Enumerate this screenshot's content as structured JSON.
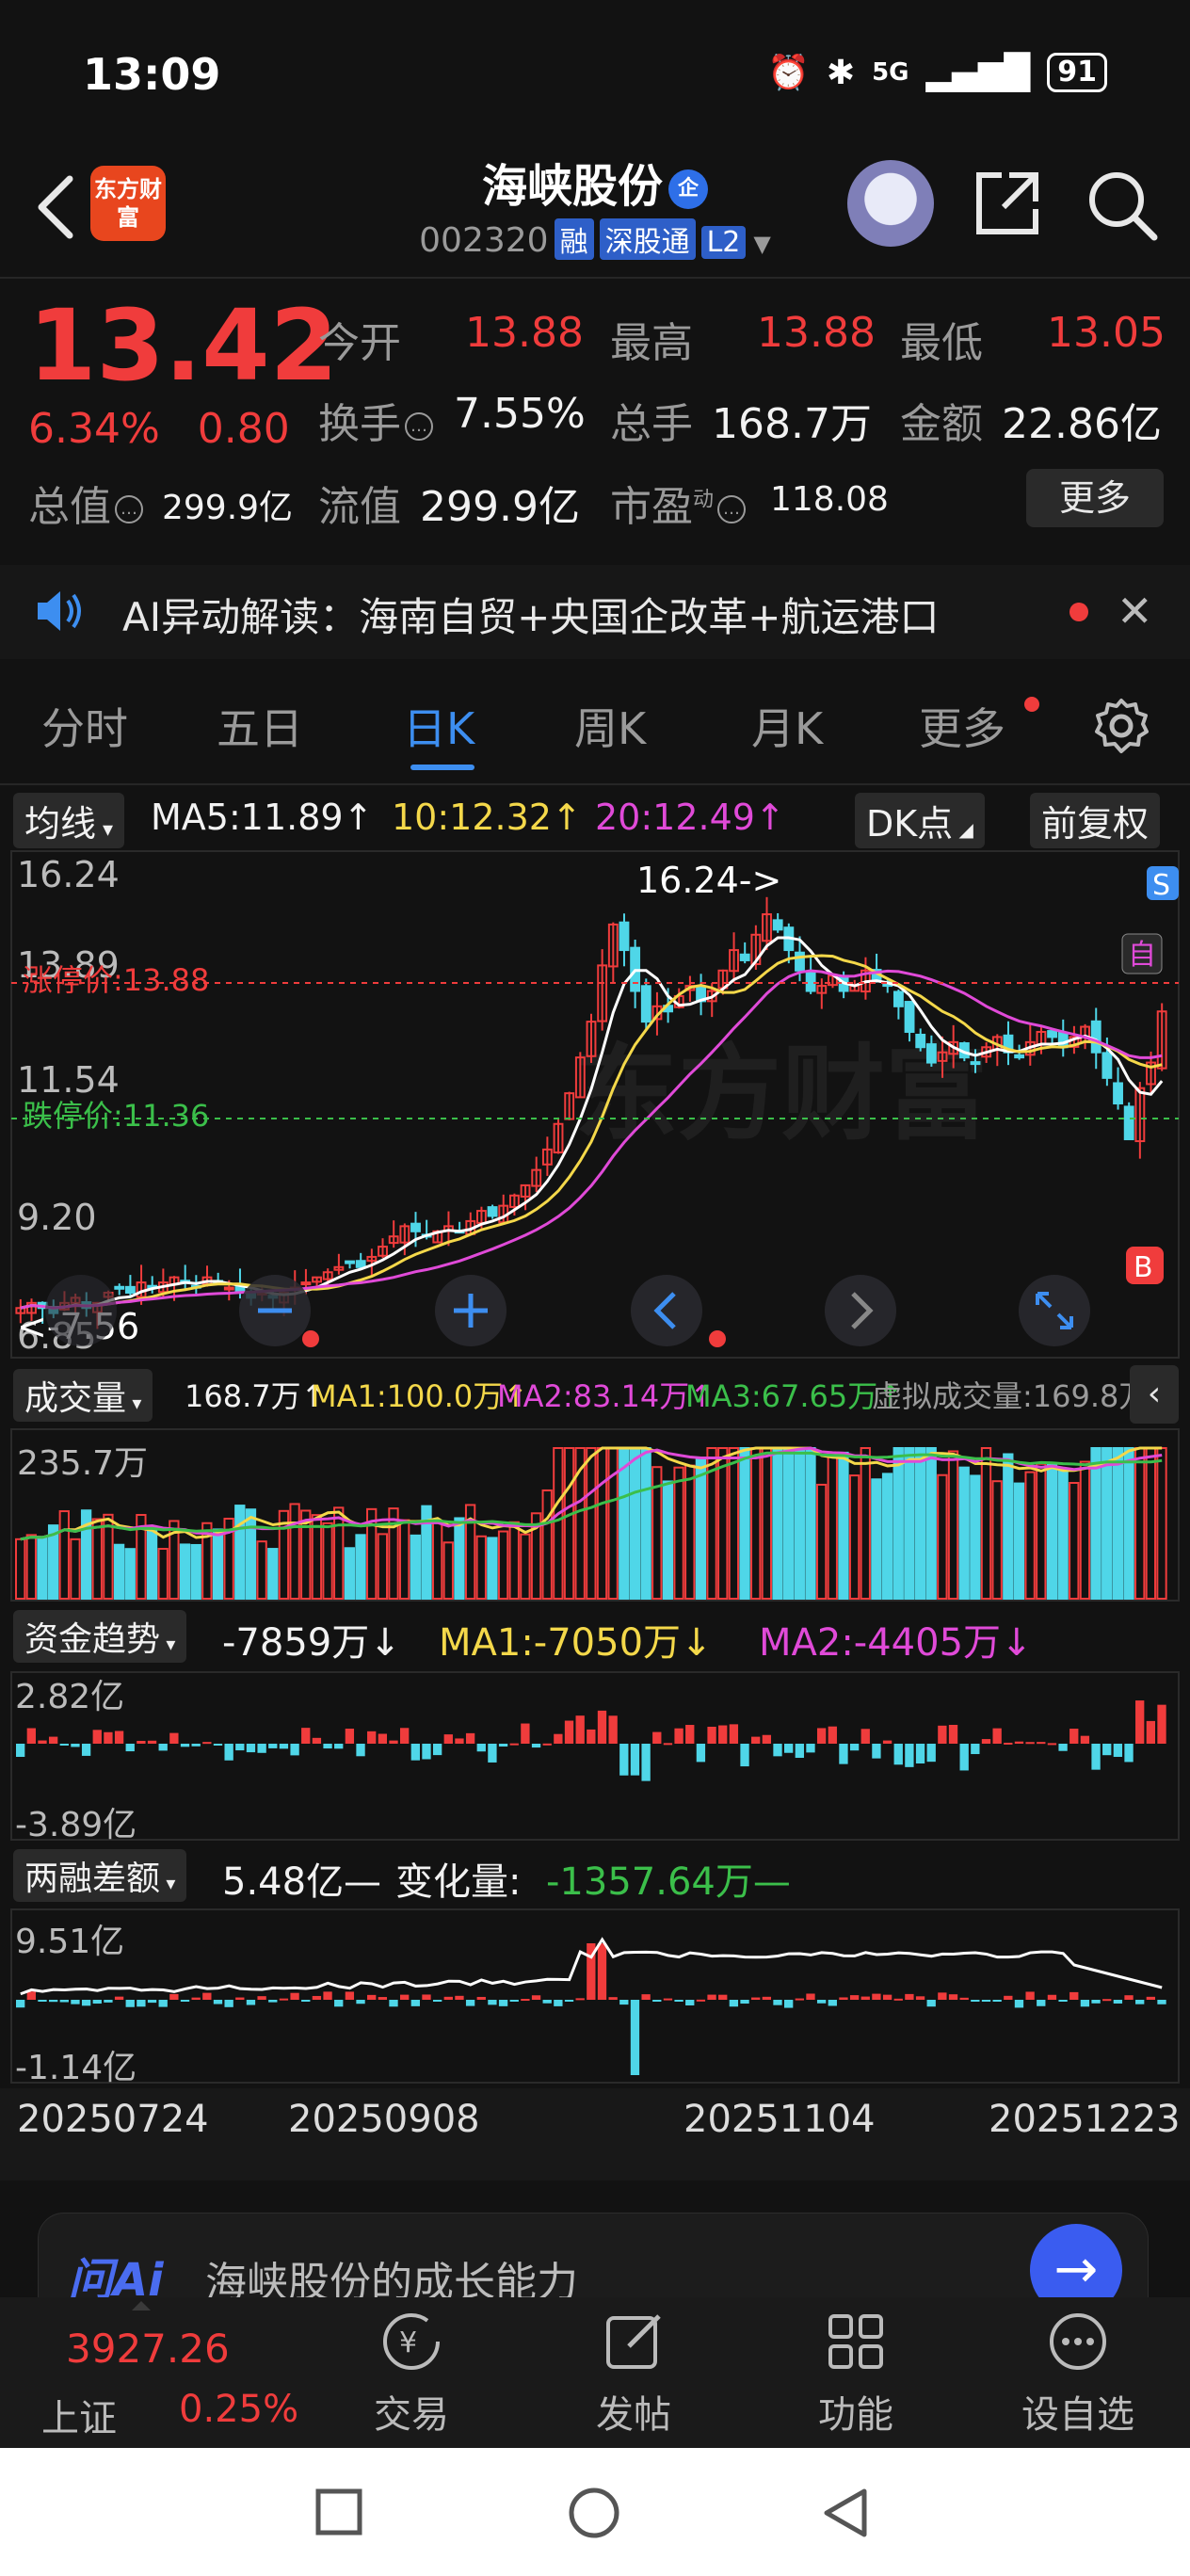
{
  "status": {
    "time": "13:09",
    "network": "5G",
    "battery": "91"
  },
  "header": {
    "logo_text": "东方财富",
    "name": "海峡股份",
    "name_badge": "企",
    "code": "002320",
    "tags": [
      "融",
      "深股通",
      "L2"
    ]
  },
  "quote": {
    "price": "13.42",
    "change_pct": "6.34%",
    "change_amt": "0.80",
    "open_label": "今开",
    "open": "13.88",
    "high_label": "最高",
    "high": "13.88",
    "low_label": "最低",
    "low": "13.05",
    "turnover_label": "换手",
    "turnover": "7.55%",
    "volume_label": "总手",
    "volume": "168.7万",
    "amount_label": "金额",
    "amount": "22.86亿",
    "mktcap_label": "总值",
    "mktcap": "299.9亿",
    "float_label": "流值",
    "float": "299.9亿",
    "pe_label": "市盈",
    "pe_sup": "动",
    "pe": "118.08",
    "more_label": "更多"
  },
  "ai_bar": {
    "text": "AI异动解读：海南自贸+央国企改革+航运港口"
  },
  "tabs": [
    "分时",
    "五日",
    "日K",
    "周K",
    "月K",
    "更多"
  ],
  "active_tab": "日K",
  "kline": {
    "ma_chip": "均线",
    "ma5": "MA5:11.89↑",
    "ma10": "10:12.32↑",
    "ma20": "20:12.49↑",
    "dk_chip": "DK点",
    "adj_chip": "前复权",
    "y_labels": [
      "16.24",
      "13.89",
      "11.54",
      "9.20",
      "6.85"
    ],
    "limit_up": "涨停价:13.88",
    "limit_down": "跌停价:11.36",
    "high_marker": "16.24->",
    "low_marker": "<-7.56",
    "badge_s": "S",
    "badge_zi": "自",
    "badge_b": "B",
    "watermark": "东方财富"
  },
  "volume_panel": {
    "chip": "成交量",
    "vol": "168.7万↑",
    "ma1": "MA1:100.0万↑",
    "ma2": "MA2:83.14万↑",
    "ma3": "MA3:67.65万↑",
    "virtual": "虚拟成交量:169.8万",
    "y_top": "235.7万"
  },
  "fund_panel": {
    "chip": "资金趋势",
    "val": "-7859万↓",
    "ma1": "MA1:-7050万↓",
    "ma2": "MA2:-4405万↓",
    "y_top": "2.82亿",
    "y_bottom": "-3.89亿"
  },
  "margin_panel": {
    "chip": "两融差额",
    "val": "5.48亿—",
    "change_label": "变化量:",
    "change": "-1357.64万—",
    "y_top": "9.51亿",
    "y_bottom": "-1.14亿"
  },
  "dates": [
    "20250724",
    "20250908",
    "20251104",
    "20251223"
  ],
  "ask_ai": {
    "logo": "问Ai",
    "text": "海峡股份的成长能力"
  },
  "index": {
    "value": "3927.26",
    "name": "上证",
    "pct": "0.25%"
  },
  "nav": [
    "交易",
    "发帖",
    "功能",
    "设自选"
  ],
  "colors": {
    "up": "#f03c3c",
    "down": "#4fd6e8",
    "accent": "#3d8ef0",
    "ma5": "#ffffff",
    "ma10": "#f4d84a",
    "ma20": "#e04ad8"
  },
  "chart_data": {
    "type": "candlestick",
    "x_range": [
      "20250724",
      "20251230"
    ],
    "ylim": [
      6.85,
      16.24
    ],
    "closes": [
      7.6,
      7.7,
      7.6,
      7.5,
      7.7,
      7.8,
      7.6,
      7.7,
      7.9,
      8.0,
      7.9,
      8.1,
      8.0,
      8.1,
      8.2,
      8.1,
      8.0,
      8.2,
      8.1,
      8.0,
      7.9,
      7.8,
      7.9,
      7.8,
      7.9,
      8.0,
      8.1,
      8.2,
      8.3,
      8.4,
      8.5,
      8.4,
      8.6,
      8.8,
      9.0,
      9.2,
      9.1,
      9.0,
      9.1,
      9.2,
      9.1,
      9.3,
      9.5,
      9.4,
      9.6,
      9.8,
      10.0,
      10.3,
      10.7,
      11.2,
      11.8,
      12.5,
      13.2,
      14.3,
      15.1,
      14.6,
      13.8,
      13.2,
      13.5,
      13.4,
      13.7,
      13.9,
      13.6,
      13.8,
      14.2,
      14.6,
      14.4,
      14.9,
      15.3,
      15.0,
      14.6,
      14.2,
      13.8,
      13.9,
      14.1,
      13.8,
      13.9,
      14.2,
      14.0,
      13.9,
      13.5,
      13.0,
      12.7,
      12.4,
      12.6,
      12.8,
      12.5,
      12.4,
      12.7,
      12.9,
      12.6,
      12.5,
      12.8,
      13.0,
      12.9,
      12.7,
      12.9,
      13.1,
      12.6,
      12.1,
      11.6,
      10.9,
      11.9,
      12.4,
      13.4
    ],
    "volume_y_top": "235.7万"
  }
}
